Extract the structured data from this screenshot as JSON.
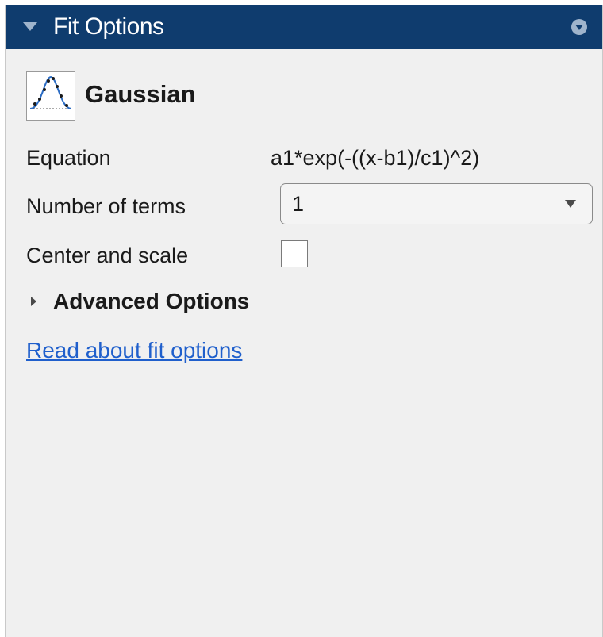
{
  "header": {
    "title": "Fit Options",
    "collapse_icon": "triangle-down-icon",
    "help_icon": "help-circle-icon",
    "background_color": "#0f3c6e"
  },
  "fit": {
    "type_label": "Gaussian",
    "icon": "gaussian-fit-icon"
  },
  "fields": {
    "equation_label": "Equation",
    "equation_value": "a1*exp(-((x-b1)/c1)^2)",
    "terms_label": "Number of terms",
    "terms_value": "1",
    "center_scale_label": "Center and scale",
    "center_scale_checked": false
  },
  "advanced": {
    "label": "Advanced Options",
    "expanded": false,
    "icon": "triangle-right-icon"
  },
  "link": {
    "text": "Read about fit options",
    "color": "#1f5fcc"
  }
}
